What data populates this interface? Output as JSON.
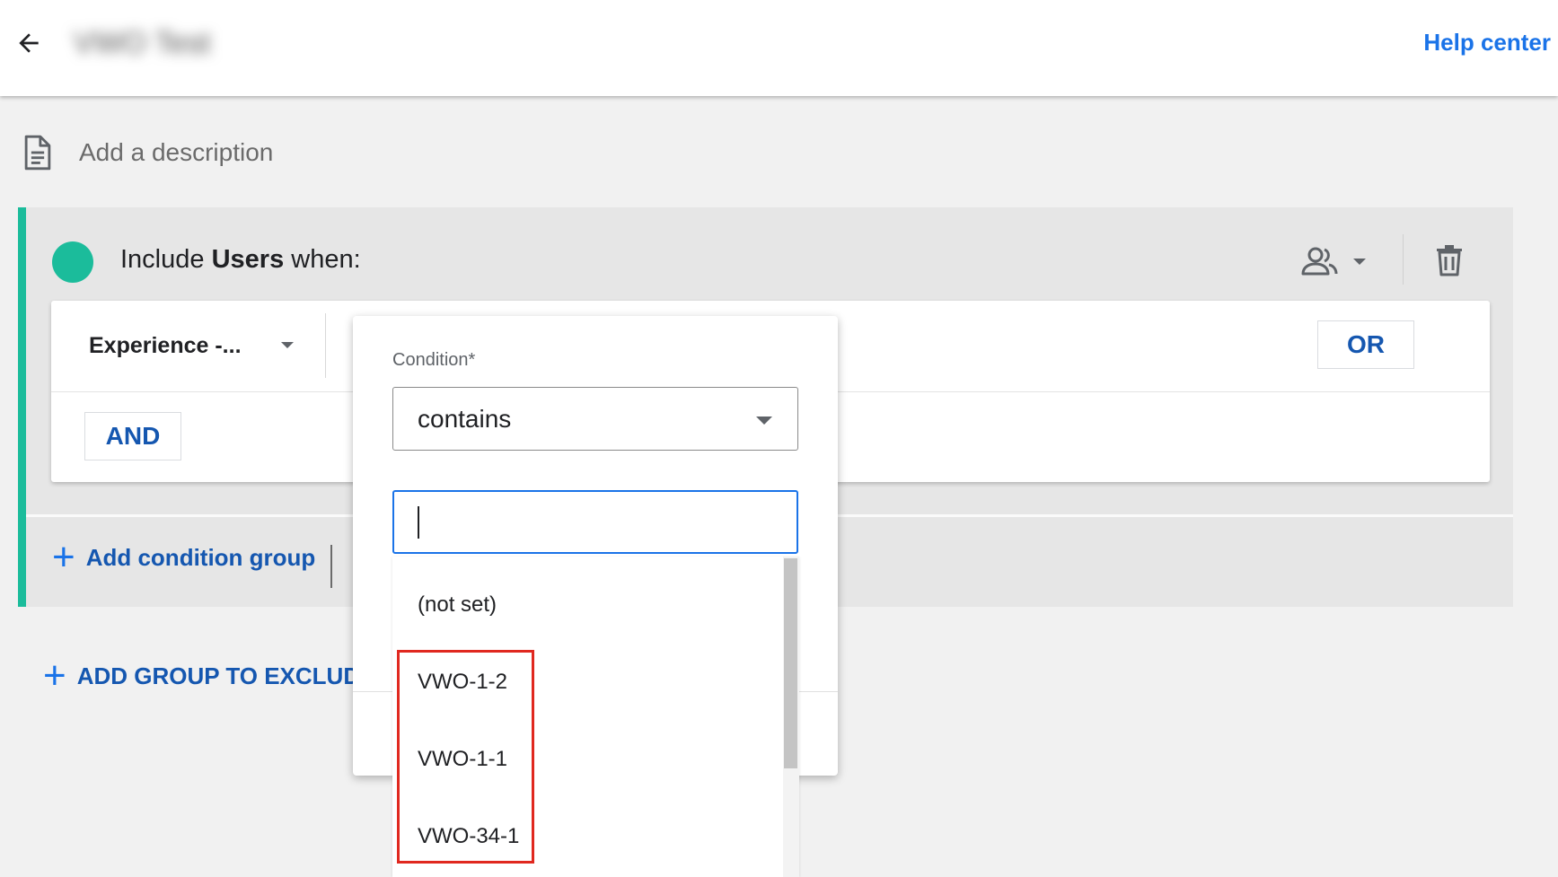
{
  "header": {
    "back_icon": "arrow-left-icon",
    "title_blurred": "VWO Test",
    "help_link": "Help center"
  },
  "description": {
    "icon": "document-icon",
    "placeholder": "Add a description"
  },
  "include_group": {
    "accent_color": "#1bbc9b",
    "prefix": "Include",
    "scope": "Users",
    "suffix": "when:",
    "scope_icon": "users-icon",
    "delete_icon": "trash-icon",
    "condition": {
      "dimension_label": "Experience -...",
      "or_label": "OR",
      "and_label": "AND"
    },
    "add_condition_group": "Add condition group"
  },
  "add_exclude_group": "ADD GROUP TO EXCLUDE",
  "condition_popup": {
    "label": "Condition*",
    "selected": "contains",
    "value": "",
    "options": [
      "(not set)",
      "VWO-1-2",
      "VWO-1-1",
      "VWO-34-1"
    ]
  },
  "colors": {
    "link_blue": "#1a73e8",
    "button_blue": "#1557b0",
    "highlight_red": "#e0281f"
  }
}
